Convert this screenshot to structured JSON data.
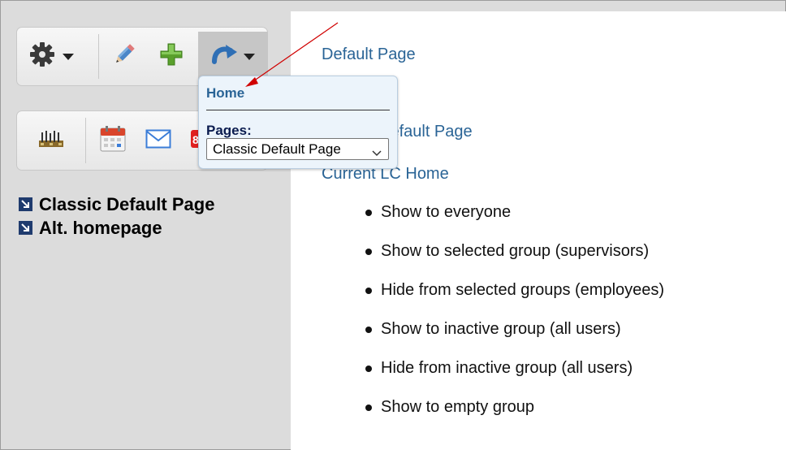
{
  "main": {
    "links": {
      "default_page": "Default Page",
      "classic_default_page": "Classic Default Page",
      "current_lc_home": "Current LC Home"
    },
    "items": [
      "Show to everyone",
      "Show to selected group (supervisors)",
      "Hide from selected groups (employees)",
      "Show to inactive group (all users)",
      "Hide from inactive group (all users)",
      "Show to empty group"
    ]
  },
  "toolbar_top": {
    "icons": [
      "gear-icon",
      "pencil-icon",
      "plus-icon",
      "redo-icon"
    ]
  },
  "toolbar_bottom": {
    "icons": [
      "timeclock-icon",
      "calendar-icon",
      "mail-icon",
      "badge-icon"
    ]
  },
  "sidebar": {
    "items": [
      "Classic Default Page",
      "Alt. homepage"
    ]
  },
  "dropdown": {
    "home": "Home",
    "pages_label": "Pages:",
    "selected_page": "Classic Default Page"
  },
  "colors": {
    "link": "#2a6496",
    "annotation_arrow": "#d00000"
  }
}
